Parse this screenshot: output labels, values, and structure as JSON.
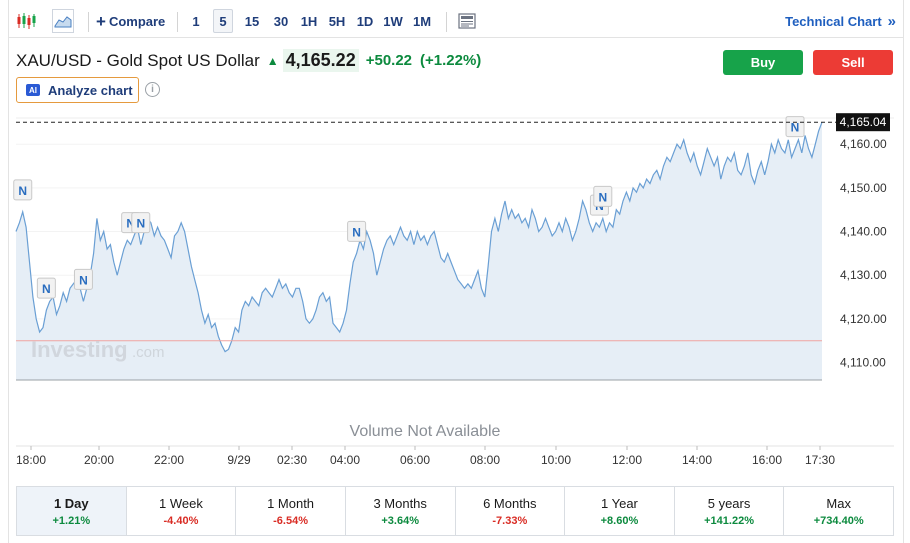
{
  "toolbar": {
    "compare_label": "Compare",
    "intervals": [
      "1",
      "5",
      "15",
      "30",
      "1H",
      "5H",
      "1D",
      "1W",
      "1M"
    ],
    "active_interval": "5",
    "technical_chart_label": "Technical Chart",
    "icons": [
      "candlestick-icon",
      "area-chart-icon",
      "plus-icon",
      "news-icon",
      "double-chevron-right-icon"
    ]
  },
  "instrument": {
    "name": "XAU/USD - Gold Spot US Dollar",
    "price": "4,165.22",
    "change": "+50.22",
    "change_pct": "(+1.22%)"
  },
  "actions": {
    "buy": "Buy",
    "sell": "Sell"
  },
  "analyze": {
    "badge": "AI",
    "label": "Analyze chart",
    "info": "i"
  },
  "watermark": {
    "brand": "Investing",
    "suffix": ".com"
  },
  "volume_note": "Volume Not Available",
  "news_marker_label": "N",
  "colors": {
    "line": "#6a9fd4",
    "fill": "#e6eef6",
    "buy": "#17a34a",
    "sell": "#ec3b35",
    "positive": "#0c8a3e",
    "negative": "#d92c24"
  },
  "chart_data": {
    "type": "area",
    "x_tick_labels": [
      "18:00",
      "20:00",
      "22:00",
      "9/29",
      "02:30",
      "04:00",
      "06:00",
      "08:00",
      "10:00",
      "12:00",
      "14:00",
      "16:00",
      "17:30"
    ],
    "y_tick_labels": [
      "4,110.00",
      "4,120.00",
      "4,130.00",
      "4,140.00",
      "4,150.00",
      "4,160.00"
    ],
    "y_ticks": [
      4110,
      4120,
      4130,
      4140,
      4150,
      4160
    ],
    "ylim": [
      4106,
      4166
    ],
    "last_price_label": "4,165.04",
    "last_price": 4165.04,
    "reference_level": 4115,
    "values": [
      4140,
      4142,
      4144.5,
      4141,
      4133,
      4125,
      4120,
      4117,
      4118,
      4122,
      4124,
      4125,
      4121,
      4123,
      4126,
      4124,
      4127,
      4128,
      4129,
      4127,
      4124,
      4127,
      4130,
      4135,
      4143,
      4138,
      4140,
      4136,
      4137,
      4133,
      4130,
      4133,
      4136,
      4138,
      4137,
      4139,
      4141,
      4137,
      4140,
      4143,
      4142,
      4139,
      4141,
      4139,
      4138,
      4136,
      4134,
      4139,
      4140,
      4142,
      4140,
      4136,
      4132,
      4129,
      4126,
      4122,
      4119,
      4121,
      4118,
      4119,
      4116,
      4114,
      4112.5,
      4113,
      4115,
      4118,
      4117,
      4122,
      4124,
      4123,
      4125,
      4124,
      4123,
      4126,
      4127,
      4126,
      4125,
      4127,
      4129,
      4127,
      4128,
      4126,
      4125,
      4127,
      4127,
      4124,
      4120,
      4119,
      4120,
      4122,
      4125,
      4126,
      4124,
      4125,
      4119,
      4118,
      4117,
      4119,
      4122,
      4128,
      4133,
      4135,
      4138,
      4136,
      4140,
      4138,
      4135,
      4130,
      4133,
      4136,
      4138,
      4139,
      4137,
      4139,
      4141,
      4139,
      4138,
      4140,
      4137,
      4140,
      4138,
      4139,
      4137,
      4139,
      4140,
      4137,
      4134,
      4133,
      4135,
      4133,
      4131,
      4129,
      4128,
      4127,
      4128,
      4127,
      4129,
      4131,
      4127,
      4125,
      4132,
      4140,
      4143,
      4140,
      4144,
      4147,
      4143,
      4145,
      4143,
      4144,
      4142,
      4143,
      4141,
      4145,
      4143,
      4140,
      4141,
      4143,
      4141,
      4139,
      4140,
      4142,
      4140,
      4143,
      4141,
      4138,
      4140,
      4143,
      4147,
      4145,
      4142,
      4140,
      4142,
      4141,
      4143,
      4140,
      4142,
      4141,
      4145,
      4144,
      4147,
      4149,
      4147,
      4150,
      4149,
      4151,
      4150,
      4152,
      4151,
      4153,
      4154,
      4152,
      4155,
      4157,
      4156,
      4158,
      4160,
      4159,
      4161,
      4158,
      4156,
      4158,
      4155,
      4153,
      4156,
      4159,
      4157,
      4155,
      4157,
      4152,
      4155,
      4157,
      4156,
      4158,
      4154,
      4153,
      4155,
      4158,
      4153,
      4151,
      4154,
      4156,
      4153,
      4156,
      4160,
      4158,
      4161,
      4159,
      4158,
      4161,
      4157,
      4159,
      4161,
      4158,
      4162,
      4159,
      4157,
      4160,
      4163,
      4165.04
    ],
    "news_markers": [
      {
        "label": "N",
        "index": 2
      },
      {
        "label": "N",
        "index": 9
      },
      {
        "label": "N",
        "index": 20
      },
      {
        "label": "N",
        "index": 34
      },
      {
        "label": "N",
        "index": 37
      },
      {
        "label": "N",
        "index": 101
      },
      {
        "label": "N",
        "index": 173
      },
      {
        "label": "N",
        "index": 174
      },
      {
        "label": "N",
        "index": 231
      }
    ]
  },
  "periods": [
    {
      "label": "1 Day",
      "value": "+1.21%",
      "dir": "pos",
      "active": true
    },
    {
      "label": "1 Week",
      "value": "-4.40%",
      "dir": "neg",
      "active": false
    },
    {
      "label": "1 Month",
      "value": "-6.54%",
      "dir": "neg",
      "active": false
    },
    {
      "label": "3 Months",
      "value": "+3.64%",
      "dir": "pos",
      "active": false
    },
    {
      "label": "6 Months",
      "value": "-7.33%",
      "dir": "neg",
      "active": false
    },
    {
      "label": "1 Year",
      "value": "+8.60%",
      "dir": "pos",
      "active": false
    },
    {
      "label": "5 years",
      "value": "+141.22%",
      "dir": "pos",
      "active": false
    },
    {
      "label": "Max",
      "value": "+734.40%",
      "dir": "pos",
      "active": false
    }
  ]
}
